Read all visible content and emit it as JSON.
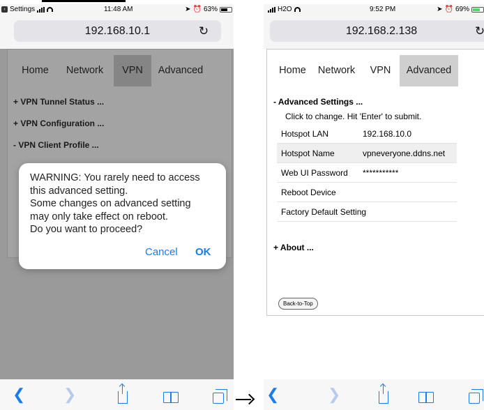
{
  "left_phone": {
    "status": {
      "back_app": "Settings",
      "time": "11:48 AM",
      "battery": "63%",
      "battery_level": 0.63
    },
    "url": "192.168.10.1",
    "tabs": [
      {
        "label": "Home",
        "active": false
      },
      {
        "label": "Network",
        "active": false
      },
      {
        "label": "VPN",
        "active": true
      },
      {
        "label": "Advanced",
        "active": false
      }
    ],
    "sections": [
      "+ VPN Tunnel Status ...",
      "+ VPN Configuration ...",
      "- VPN Client Profile ..."
    ],
    "dialog": {
      "lines": [
        "WARNING: You rarely need to access",
        "this advanced setting.",
        "Some changes on advanced setting",
        "may only take effect on reboot.",
        "Do you want to proceed?"
      ],
      "cancel": "Cancel",
      "ok": "OK"
    }
  },
  "right_phone": {
    "status": {
      "carrier": "H2O",
      "time": "9:52 PM",
      "battery": "69%",
      "battery_level": 0.69
    },
    "url": "192.168.2.138",
    "tabs": [
      {
        "label": "Home",
        "active": false
      },
      {
        "label": "Network",
        "active": false
      },
      {
        "label": "VPN",
        "active": false
      },
      {
        "label": "Advanced",
        "active": true
      }
    ],
    "advanced_heading": "- Advanced Settings ...",
    "hint": "Click to change. Hit 'Enter' to submit.",
    "settings": [
      {
        "key": "Hotspot LAN",
        "value": "192.168.10.0"
      },
      {
        "key": "Hotspot Name",
        "value": "vpneveryone.ddns.net"
      },
      {
        "key": "Web UI Password",
        "value": "***********"
      },
      {
        "key": "Reboot Device",
        "value": ""
      },
      {
        "key": "Factory Default Setting",
        "value": ""
      }
    ],
    "about": "+ About ...",
    "back_to_top": "Back-to-Top"
  },
  "toolbar_icons": [
    "back-icon",
    "forward-icon",
    "share-icon",
    "bookmarks-icon",
    "tabs-icon"
  ],
  "colors": {
    "accent": "#1a7cf0",
    "active_tab": "#cfcfcf",
    "dim_overlay": "#9a9a9a",
    "battery_green": "#4cd964"
  }
}
